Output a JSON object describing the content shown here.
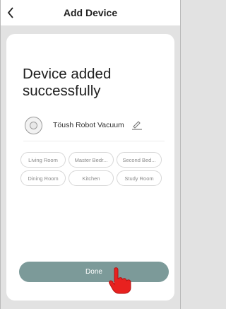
{
  "header": {
    "title": "Add Device",
    "back_icon": "chevron-left-icon"
  },
  "main": {
    "headline": "Device added successfully",
    "device": {
      "icon": "robot-vacuum-icon",
      "name": "Töush Robot Vacuum",
      "edit_icon": "pencil-icon"
    },
    "rooms": [
      "Living Room",
      "Master Bedr...",
      "Second Bed...",
      "Dining Room",
      "Kitchen",
      "Study Room"
    ],
    "done_label": "Done"
  },
  "overlay": {
    "pointer_icon": "pointing-hand-icon"
  },
  "colors": {
    "done_button": "#7c9a99",
    "background": "#e2e2e2",
    "pointer": "#e8211f"
  }
}
